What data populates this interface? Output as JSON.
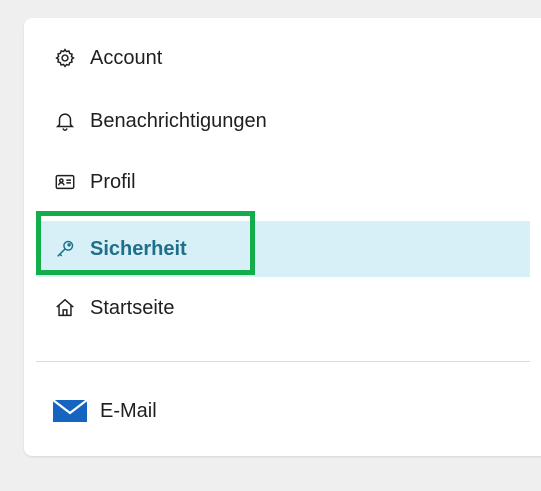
{
  "menu": {
    "items": [
      {
        "label": "Account",
        "icon": "gear-icon"
      },
      {
        "label": "Benachrichtigungen",
        "icon": "bell-icon"
      },
      {
        "label": "Profil",
        "icon": "id-card-icon"
      },
      {
        "label": "Sicherheit",
        "icon": "key-icon",
        "active": true
      },
      {
        "label": "Startseite",
        "icon": "home-icon"
      }
    ]
  },
  "footer": {
    "email_label": "E-Mail",
    "email_icon": "mail-icon"
  },
  "colors": {
    "active_bg": "#d7eff6",
    "active_text": "#1f6f88",
    "highlight": "#14ad4b",
    "mail_blue": "#1565c0"
  }
}
